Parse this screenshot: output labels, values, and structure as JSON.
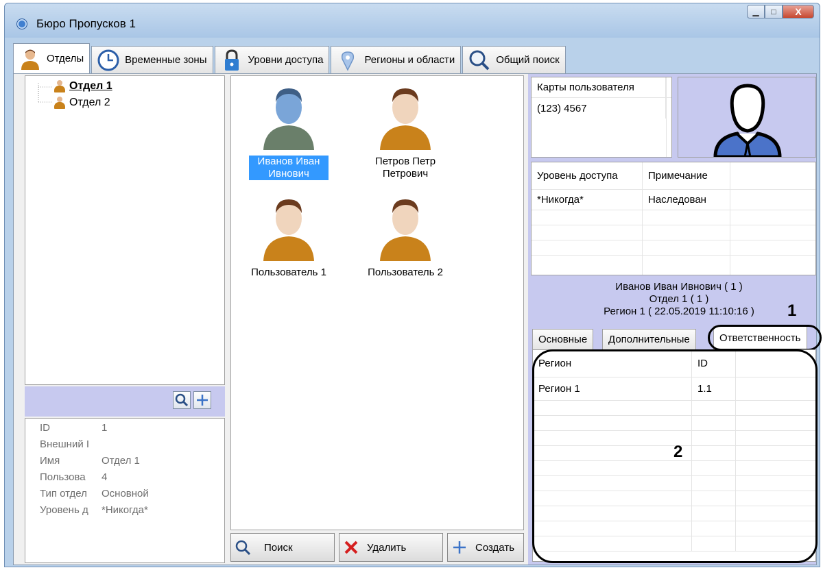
{
  "window": {
    "title": "Бюро Пропусков 1",
    "minimize_glyph": "▁",
    "maximize_glyph": "□",
    "close_glyph": "X"
  },
  "tabs": [
    {
      "label": "Отделы",
      "icon": "person-icon",
      "active": true
    },
    {
      "label": "Временные зоны",
      "icon": "clock-icon"
    },
    {
      "label": "Уровни доступа",
      "icon": "lock-icon"
    },
    {
      "label": "Регионы и области",
      "icon": "map-pin-icon"
    },
    {
      "label": "Общий поиск",
      "icon": "search-icon"
    }
  ],
  "departments": {
    "tree": [
      {
        "label": "Отдел 1",
        "selected": true
      },
      {
        "label": "Отдел 2",
        "selected": false
      }
    ],
    "properties": [
      {
        "key": "ID",
        "value": "1"
      },
      {
        "key": "Внешний I",
        "value": ""
      },
      {
        "key": "Имя",
        "value": "Отдел 1"
      },
      {
        "key": "Пользова",
        "value": "4"
      },
      {
        "key": "Тип отдел",
        "value": "Основной"
      },
      {
        "key": "Уровень д",
        "value": "*Никогда*"
      }
    ]
  },
  "users": [
    {
      "name": "Иванов Иван Ивнович",
      "selected": true
    },
    {
      "name": "Петров Петр Петрович",
      "selected": false
    },
    {
      "name": "Пользователь 1",
      "selected": false
    },
    {
      "name": "Пользователь 2",
      "selected": false
    }
  ],
  "user_actions": {
    "search_label": "Поиск",
    "delete_label": "Удалить",
    "create_label": "Создать"
  },
  "cards": {
    "header": "Карты пользователя",
    "rows": [
      "(123) 4567"
    ]
  },
  "access": {
    "columns": [
      "Уровень доступа",
      "Примечание"
    ],
    "rows": [
      [
        "*Никогда*",
        "Наследован"
      ]
    ]
  },
  "user_info": {
    "line1": "Иванов Иван Ивнович ( 1 )",
    "line2": "Отдел 1 ( 1 )",
    "line3": "Регион 1 ( 22.05.2019 11:10:16 )"
  },
  "detail_tabs": [
    {
      "label": "Основные"
    },
    {
      "label": "Дополнительные"
    },
    {
      "label": "Ответственность",
      "active": true
    }
  ],
  "responsibility": {
    "columns": [
      "Регион",
      "ID"
    ],
    "rows": [
      [
        "Регион 1",
        "1.1"
      ]
    ]
  },
  "callouts": [
    "1",
    "2"
  ],
  "colors": {
    "selection": "#3399ff",
    "panel_lavender": "#c7c9ef",
    "avatar_selected": "#7aa5d8",
    "avatar_shirt": "#c9821b"
  }
}
